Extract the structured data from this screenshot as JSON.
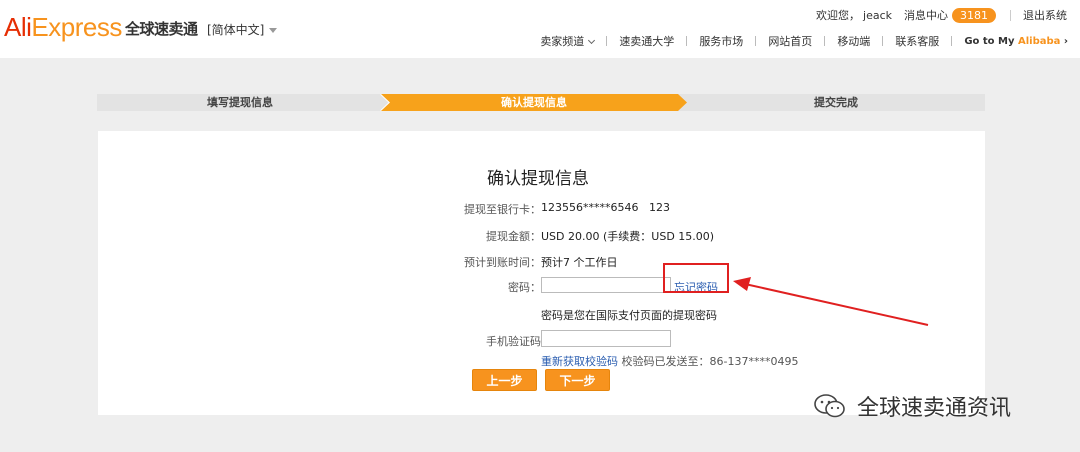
{
  "header": {
    "logo_ali": "Ali",
    "logo_express": "Express",
    "logo_cn": "全球速卖通",
    "language": "[简体中文]",
    "greeting": "欢迎您，",
    "username": "jeack",
    "messages_label": "消息中心",
    "messages_count": "3181",
    "logout": "退出系统"
  },
  "nav": {
    "items": [
      "卖家频道",
      "速卖通大学",
      "服务市场",
      "网站首页",
      "移动端",
      "联系客服"
    ],
    "goto_prefix": "Go to My",
    "goto_brand": "Alibaba"
  },
  "steps": [
    "填写提现信息",
    "确认提现信息",
    "提交完成"
  ],
  "form": {
    "title": "确认提现信息",
    "bank_label": "提现至银行卡：",
    "bank_value": "123556*****6546   123",
    "amount_label": "提现金额：",
    "amount_value": "USD 20.00 (手续费：USD 15.00)",
    "eta_label": "预计到账时间：",
    "eta_value": "预计7 个工作日",
    "password_label": "密码：",
    "password_value": "",
    "forgot_password": "忘记密码",
    "password_hint": "密码是您在国际支付页面的提现密码",
    "sms_label": "手机验证码",
    "sms_value": "",
    "resend_code": "重新获取校验码",
    "sent_to": "校验码已发送至：86-137****0495",
    "prev_button": "上一步",
    "next_button": "下一步"
  },
  "watermark": "全球速卖通资讯",
  "colors": {
    "accent": "#f7931e",
    "active_step": "#f7a21b",
    "highlight": "#e02020",
    "link": "#2a5db0"
  }
}
